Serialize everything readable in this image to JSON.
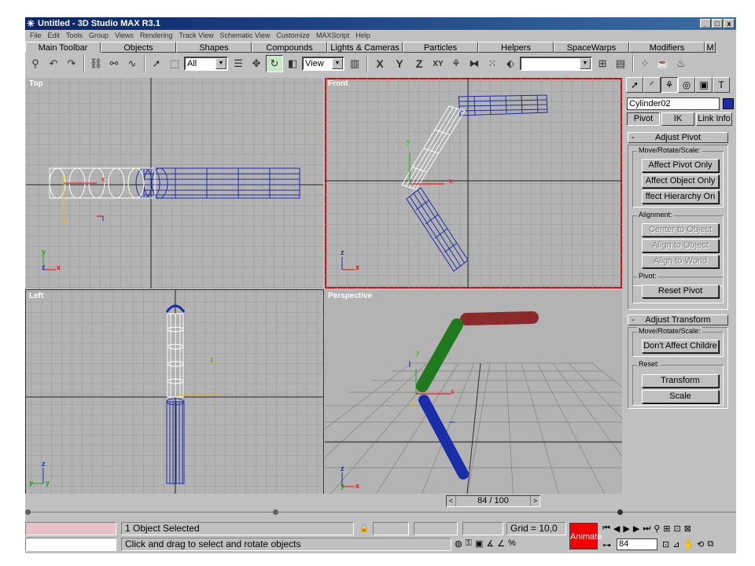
{
  "window": {
    "title": "Untitled - 3D Studio MAX R3.1",
    "controls": [
      "_",
      "□",
      "x"
    ]
  },
  "menu": [
    "File",
    "Edit",
    "Tools",
    "Group",
    "Views",
    "Rendering",
    "Track View",
    "Schematic View",
    "Customize",
    "MAXScript",
    "Help"
  ],
  "tabs": [
    "Main Toolbar",
    "Objects",
    "Shapes",
    "Compounds",
    "Lights & Cameras",
    "Particles",
    "Helpers",
    "SpaceWarps",
    "Modifiers",
    "M"
  ],
  "toolbar": {
    "selection_filter": "All",
    "coord_system": "View",
    "axis_labels": [
      "X",
      "Y",
      "Z",
      "XY"
    ],
    "named_selection": ""
  },
  "viewports": [
    {
      "label": "Top"
    },
    {
      "label": "Front"
    },
    {
      "label": "Left"
    },
    {
      "label": "Perspective"
    }
  ],
  "axis_letters": {
    "x": "x",
    "y": "y",
    "z": "z"
  },
  "command_panel": {
    "object_name": "Cylinder02",
    "object_color": "#1a2ea8",
    "hierarchy_tabs": [
      "Pivot",
      "IK",
      "Link Info"
    ],
    "adjust_pivot": {
      "title": "Adjust Pivot",
      "move_group": "Move/Rotate/Scale:",
      "move_buttons": [
        "Affect Pivot Only",
        "Affect Object Only",
        "ffect Hierarchy On"
      ],
      "alignment_group": "Alignment:",
      "alignment_buttons": [
        "Center to Object",
        "Align to Object",
        "Align to World"
      ],
      "pivot_group": "Pivot:",
      "reset_pivot": "Reset Pivot"
    },
    "adjust_transform": {
      "title": "Adjust Transform",
      "move_group": "Move/Rotate/Scale:",
      "dont_affect": "Don't Affect Childre",
      "reset_group": "Reset:",
      "transform": "Transform",
      "scale": "Scale"
    }
  },
  "time": {
    "slider": "84 / 100",
    "current_frame": "84",
    "progress": 0.84
  },
  "status": {
    "selection": "1 Object Selected",
    "prompt": "Click and drag to select and rotate objects",
    "grid": "Grid = 10,0",
    "animate": "Animate"
  },
  "colors": {
    "accent_active": "#d01010",
    "animate": "#f00000",
    "upper": "#8a2a2a",
    "middle": "#1f7a1f",
    "lower": "#1a2ea8"
  }
}
